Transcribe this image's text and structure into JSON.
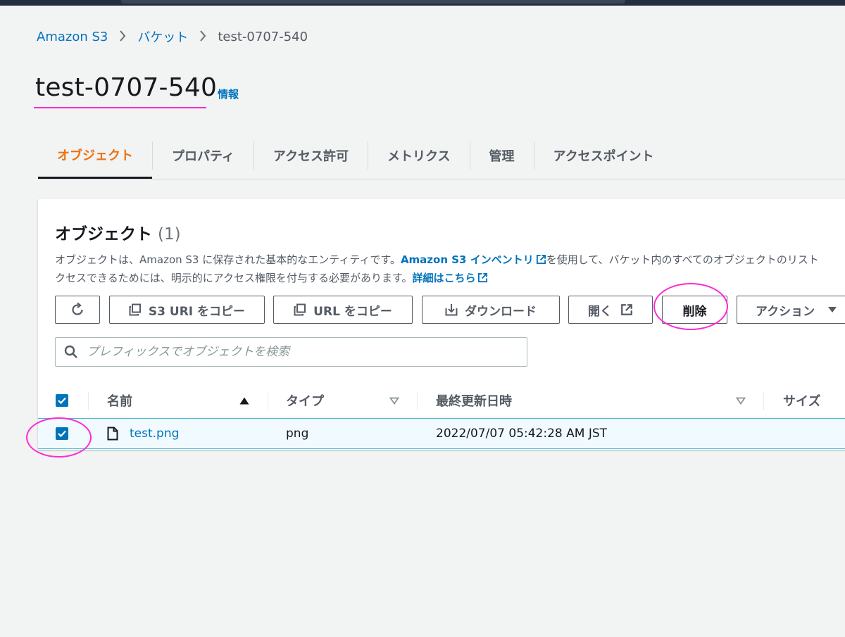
{
  "breadcrumb": {
    "root": "Amazon S3",
    "buckets": "バケット",
    "current": "test-0707-540"
  },
  "page": {
    "title": "test-0707-540",
    "info": "情報"
  },
  "tabs": [
    {
      "label": "オブジェクト",
      "active": true
    },
    {
      "label": "プロパティ",
      "active": false
    },
    {
      "label": "アクセス許可",
      "active": false
    },
    {
      "label": "メトリクス",
      "active": false
    },
    {
      "label": "管理",
      "active": false
    },
    {
      "label": "アクセスポイント",
      "active": false
    }
  ],
  "objects": {
    "title": "オブジェクト",
    "count": "(1)",
    "desc_line1_a": "オブジェクトは、Amazon S3 に保存された基本的なエンティティです。",
    "desc_link1": "Amazon S3 インベントリ",
    "desc_line1_b": "を使用して、バケット内のすべてのオブジェクトのリスト",
    "desc_line2_a": "クセスできるためには、明示的にアクセス権限を付与する必要があります。",
    "desc_link2": "詳細はこちら"
  },
  "toolbar": {
    "copy_s3_uri": "S3 URI をコピー",
    "copy_url": "URL をコピー",
    "download": "ダウンロード",
    "open": "開く",
    "delete": "削除",
    "actions": "アクション"
  },
  "search": {
    "placeholder": "プレフィックスでオブジェクトを検索"
  },
  "table": {
    "columns": {
      "name": "名前",
      "type": "タイプ",
      "last_modified": "最終更新日時",
      "size": "サイズ"
    },
    "rows": [
      {
        "name": "test.png",
        "type": "png",
        "last_modified": "2022/07/07 05:42:28 AM JST",
        "selected": true
      }
    ]
  },
  "colors": {
    "link": "#0073bb",
    "active_tab": "#ec7211",
    "annotation": "#ff2bd1",
    "checkbox": "#0073bb"
  },
  "icons": [
    "refresh-icon",
    "copy-icon",
    "download-icon",
    "external-link-icon",
    "caret-down-icon",
    "search-icon",
    "sort-asc-icon",
    "sort-desc-icon",
    "file-icon",
    "checkbox-checked-icon"
  ]
}
